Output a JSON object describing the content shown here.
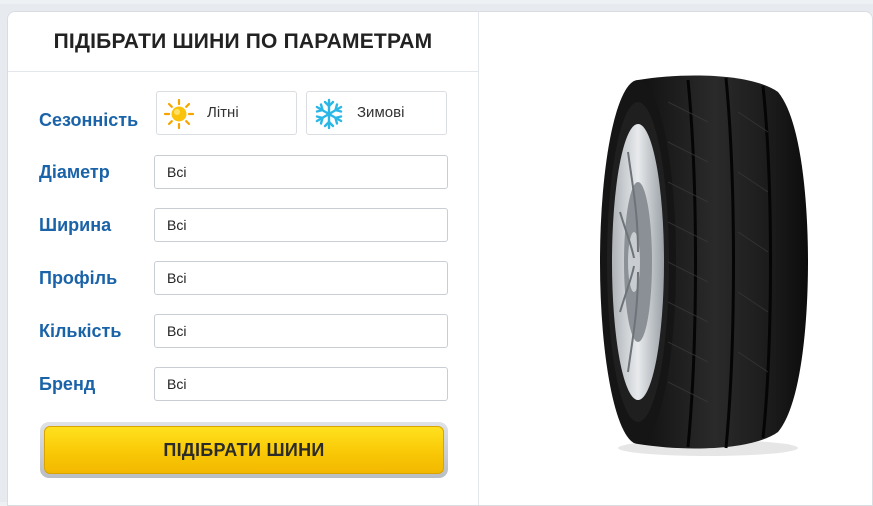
{
  "form": {
    "title": "ПІДІБРАТИ ШИНИ ПО ПАРАМЕТРАМ",
    "season": {
      "label": "Сезонність",
      "options": [
        {
          "label": "Літні",
          "icon": "sun-icon"
        },
        {
          "label": "Зимові",
          "icon": "snowflake-icon"
        }
      ]
    },
    "fields": [
      {
        "label": "Діаметр",
        "value": "Всі"
      },
      {
        "label": "Ширина",
        "value": "Всі"
      },
      {
        "label": "Профіль",
        "value": "Всі"
      },
      {
        "label": "Кількість",
        "value": "Всі"
      },
      {
        "label": "Бренд",
        "value": "Всі"
      }
    ],
    "submit_label": "ПІДІБРАТИ ШИНИ"
  },
  "colors": {
    "label_blue": "#1a63a8",
    "button_yellow": "#f9c806",
    "snowflake_blue": "#2bb7e6",
    "sun_orange": "#f7a400"
  },
  "image": {
    "icon": "tire-image"
  }
}
